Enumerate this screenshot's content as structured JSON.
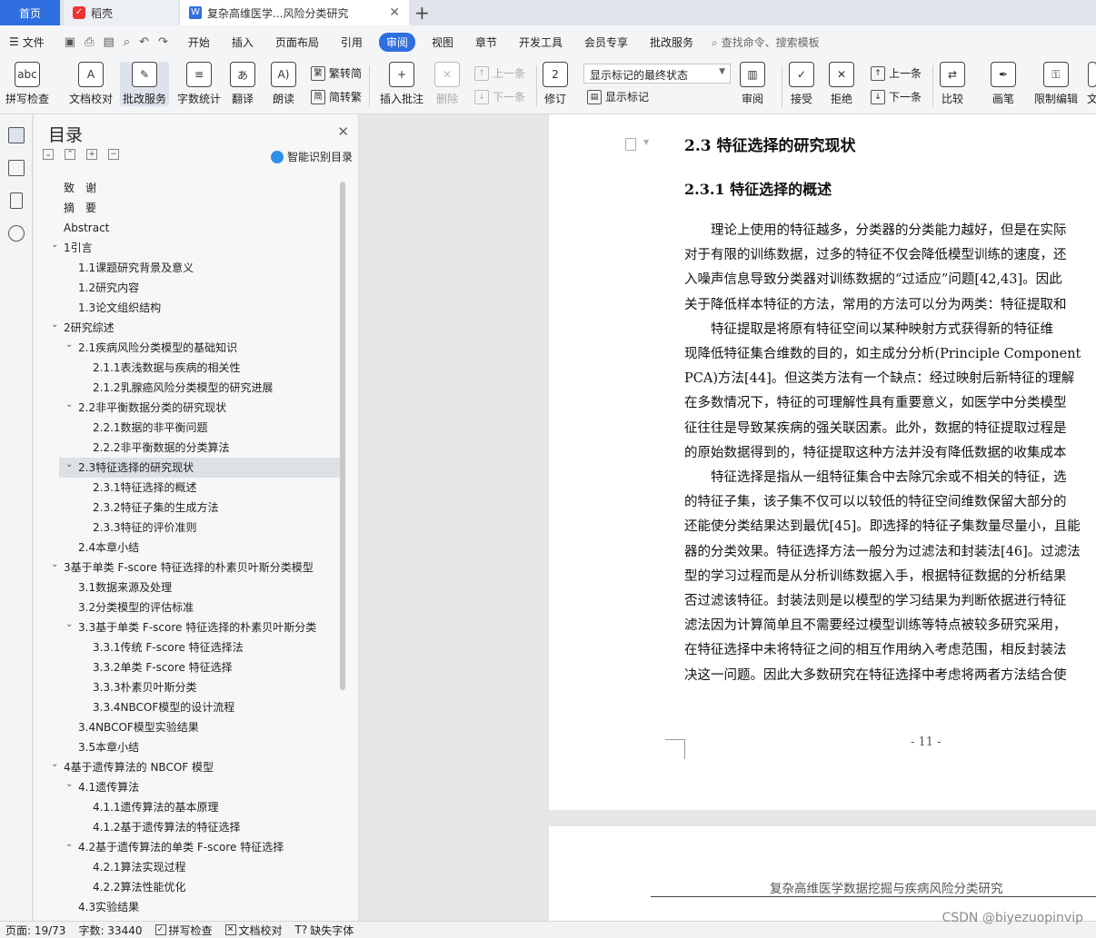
{
  "tabs": {
    "home": "首页",
    "daoke": "稻壳",
    "doc": "复杂高维医学...风险分类研究"
  },
  "menu": {
    "file": "文件",
    "items": [
      "开始",
      "插入",
      "页面布局",
      "引用",
      "审阅",
      "视图",
      "章节",
      "开发工具",
      "会员专享",
      "批改服务"
    ],
    "active_index": 4,
    "search": "查找命令、搜索模板"
  },
  "ribbon": {
    "spellcheck": "拼写检查",
    "doccheck": "文档校对",
    "correct": "批改服务",
    "wordcount": "字数统计",
    "translate": "翻译",
    "read": "朗读",
    "trad": "繁转简",
    "simp": "简转繁",
    "insert_comment": "插入批注",
    "delete": "删除",
    "prev_comment": "上一条",
    "next_comment": "下一条",
    "revise": "修订",
    "show_markup_select": "显示标记的最终状态",
    "show_markup": "显示标记",
    "review": "审阅",
    "accept": "接受",
    "reject": "拒绝",
    "prev": "上一条",
    "next": "下一条",
    "compare": "比较",
    "ink": "画笔",
    "restrict": "限制编辑",
    "more": "文"
  },
  "toc": {
    "title": "目录",
    "smart": "智能识别目录",
    "items": [
      {
        "label": "致　谢",
        "level": 0,
        "arrow": ""
      },
      {
        "label": "摘　要",
        "level": 0,
        "arrow": ""
      },
      {
        "label": "Abstract",
        "level": 0,
        "arrow": ""
      },
      {
        "label": "1引言",
        "level": 0,
        "arrow": "v"
      },
      {
        "label": "1.1课题研究背景及意义",
        "level": 1,
        "arrow": ""
      },
      {
        "label": "1.2研究内容",
        "level": 1,
        "arrow": ""
      },
      {
        "label": "1.3论文组织结构",
        "level": 1,
        "arrow": ""
      },
      {
        "label": "2研究综述",
        "level": 0,
        "arrow": "v"
      },
      {
        "label": "2.1疾病风险分类模型的基础知识",
        "level": 1,
        "arrow": "v"
      },
      {
        "label": "2.1.1表浅数据与疾病的相关性",
        "level": 2,
        "arrow": ""
      },
      {
        "label": "2.1.2乳腺癌风险分类模型的研究进展",
        "level": 2,
        "arrow": ""
      },
      {
        "label": "2.2非平衡数据分类的研究现状",
        "level": 1,
        "arrow": "v"
      },
      {
        "label": "2.2.1数据的非平衡问题",
        "level": 2,
        "arrow": ""
      },
      {
        "label": "2.2.2非平衡数据的分类算法",
        "level": 2,
        "arrow": ""
      },
      {
        "label": "2.3特征选择的研究现状",
        "level": 1,
        "arrow": "v",
        "selected": true
      },
      {
        "label": "2.3.1特征选择的概述",
        "level": 2,
        "arrow": ""
      },
      {
        "label": "2.3.2特征子集的生成方法",
        "level": 2,
        "arrow": ""
      },
      {
        "label": "2.3.3特征的评价准则",
        "level": 2,
        "arrow": ""
      },
      {
        "label": "2.4本章小结",
        "level": 1,
        "arrow": ""
      },
      {
        "label": "3基于单类 F-score 特征选择的朴素贝叶斯分类模型",
        "level": 0,
        "arrow": "v"
      },
      {
        "label": "3.1数据来源及处理",
        "level": 1,
        "arrow": ""
      },
      {
        "label": "3.2分类模型的评估标准",
        "level": 1,
        "arrow": ""
      },
      {
        "label": "3.3基于单类 F-score 特征选择的朴素贝叶斯分类",
        "level": 1,
        "arrow": "v"
      },
      {
        "label": "3.3.1传统 F-score 特征选择法",
        "level": 2,
        "arrow": ""
      },
      {
        "label": "3.3.2单类 F-score 特征选择",
        "level": 2,
        "arrow": ""
      },
      {
        "label": "3.3.3朴素贝叶斯分类",
        "level": 2,
        "arrow": ""
      },
      {
        "label": "3.3.4NBCOF模型的设计流程",
        "level": 2,
        "arrow": ""
      },
      {
        "label": "3.4NBCOF模型实验结果",
        "level": 1,
        "arrow": ""
      },
      {
        "label": "3.5本章小结",
        "level": 1,
        "arrow": ""
      },
      {
        "label": "4基于遗传算法的 NBCOF 模型",
        "level": 0,
        "arrow": "v"
      },
      {
        "label": "4.1遗传算法",
        "level": 1,
        "arrow": "v"
      },
      {
        "label": "4.1.1遗传算法的基本原理",
        "level": 2,
        "arrow": ""
      },
      {
        "label": "4.1.2基于遗传算法的特征选择",
        "level": 2,
        "arrow": ""
      },
      {
        "label": "4.2基于遗传算法的单类 F-score 特征选择",
        "level": 1,
        "arrow": "v"
      },
      {
        "label": "4.2.1算法实现过程",
        "level": 2,
        "arrow": ""
      },
      {
        "label": "4.2.2算法性能优化",
        "level": 2,
        "arrow": ""
      },
      {
        "label": "4.3实验结果",
        "level": 1,
        "arrow": ""
      }
    ]
  },
  "doc": {
    "h2": "2.3  特征选择的研究现状",
    "h3": "2.3.1  特征选择的概述",
    "lines": [
      "　　理论上使用的特征越多，分类器的分类能力越好，但是在实际",
      "对于有限的训练数据，过多的特征不仅会降低模型训练的速度，还",
      "入噪声信息导致分类器对训练数据的“过适应”问题[42,43]。因此",
      "关于降低样本特征的方法，常用的方法可以分为两类：特征提取和",
      "　　特征提取是将原有特征空间以某种映射方式获得新的特征维",
      "现降低特征集合维数的目的，如主成分分析(Principle Component",
      "PCA)方法[44]。但这类方法有一个缺点：经过映射后新特征的理解",
      "在多数情况下，特征的可理解性具有重要意义，如医学中分类模型",
      "征往往是导致某疾病的强关联因素。此外，数据的特征提取过程是",
      "的原始数据得到的，特征提取这种方法并没有降低数据的收集成本",
      "　　特征选择是指从一组特征集合中去除冗余或不相关的特征，选",
      "的特征子集，该子集不仅可以以较低的特征空间维数保留大部分的",
      "还能使分类结果达到最优[45]。即选择的特征子集数量尽量小，且能",
      "器的分类效果。特征选择方法一般分为过滤法和封装法[46]。过滤法",
      "型的学习过程而是从分析训练数据入手，根据特征数据的分析结果",
      "否过滤该特征。封装法则是以模型的学习结果为判断依据进行特征",
      "滤法因为计算简单且不需要经过模型训练等特点被较多研究采用，",
      "在特征选择中未将特征之间的相互作用纳入考虑范围，相反封装法",
      "决这一问题。因此大多数研究在特征选择中考虑将两者方法结合使"
    ],
    "page_number": "- 11 -",
    "next_header": "复杂高维医学数据挖掘与疾病风险分类研究"
  },
  "status": {
    "page": "页面: 19/73",
    "words": "字数: 33440",
    "spell": "拼写检查",
    "proof": "文档校对",
    "missing_font": "缺失字体"
  },
  "watermark": "CSDN @biyezuopinvip"
}
